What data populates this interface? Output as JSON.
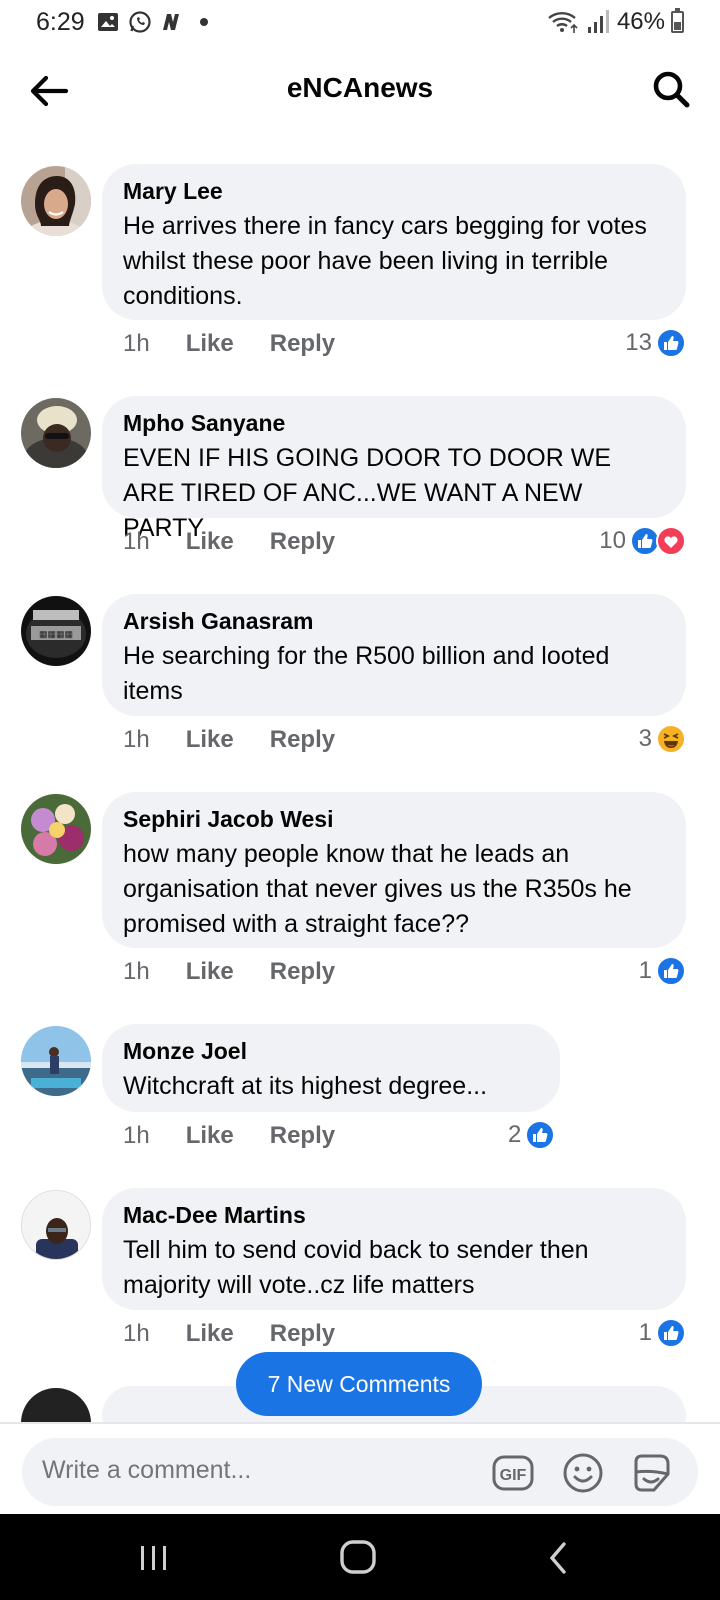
{
  "status_bar": {
    "time": "6:29",
    "battery": "46%",
    "battery_level": 0.46
  },
  "header": {
    "title": "eNCAnews"
  },
  "comments": [
    {
      "author": "Mary Lee",
      "text": "He arrives there in fancy cars begging for votes whilst these poor have been living in terrible conditions.",
      "time": "1h",
      "like": "Like",
      "reply": "Reply",
      "reaction_count": "13",
      "reactions": [
        "like"
      ]
    },
    {
      "author": "Mpho Sanyane",
      "text": "EVEN IF HIS GOING DOOR TO DOOR WE ARE TIRED OF ANC...WE WANT A NEW PARTY",
      "time": "1h",
      "like": "Like",
      "reply": "Reply",
      "reaction_count": "10",
      "reactions": [
        "like",
        "love"
      ]
    },
    {
      "author": "Arsish Ganasram",
      "text": "He searching for the R500 billion and looted items",
      "time": "1h",
      "like": "Like",
      "reply": "Reply",
      "reaction_count": "3",
      "reactions": [
        "haha"
      ]
    },
    {
      "author": "Sephiri Jacob Wesi",
      "text": "how many people know that he leads an organisation that never gives us the R350s he promised with a straight face??",
      "time": "1h",
      "like": "Like",
      "reply": "Reply",
      "reaction_count": "1",
      "reactions": [
        "like"
      ]
    },
    {
      "author": "Monze Joel",
      "text": "Witchcraft at its highest degree...",
      "time": "1h",
      "like": "Like",
      "reply": "Reply",
      "reaction_count": "2",
      "reactions": [
        "like"
      ]
    },
    {
      "author": "Mac-Dee Martins",
      "text": "Tell him to send covid back to sender then majority will vote..cz life matters",
      "time": "1h",
      "like": "Like",
      "reply": "Reply",
      "reaction_count": "1",
      "reactions": [
        "like"
      ]
    }
  ],
  "new_comments": "7 New Comments",
  "composer": {
    "placeholder": "Write a comment..."
  },
  "colors": {
    "accent": "#1b74e4",
    "bubble": "#f0f2f5",
    "love": "#f33e58",
    "haha": "#f7b125"
  }
}
